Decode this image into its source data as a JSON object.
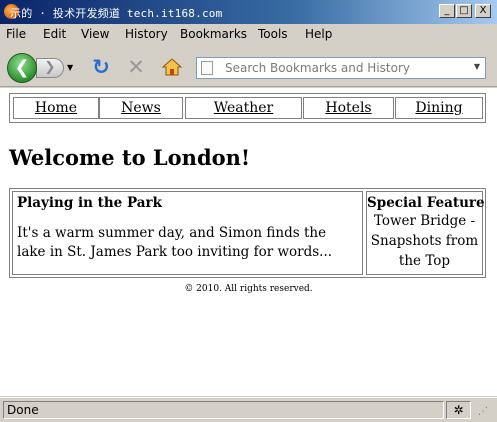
{
  "window": {
    "title": "示的   · 投术开发频道  tech.it168.com",
    "buttons": {
      "minimize": "_",
      "maximize": "□",
      "close": "X"
    }
  },
  "menu": {
    "items": [
      {
        "label": "File",
        "mnemonic": "F"
      },
      {
        "label": "Edit",
        "mnemonic": "E"
      },
      {
        "label": "View",
        "mnemonic": "V"
      },
      {
        "label": "History",
        "mnemonic": "s"
      },
      {
        "label": "Bookmarks",
        "mnemonic": "B"
      },
      {
        "label": "Tools",
        "mnemonic": "T"
      },
      {
        "label": "Help",
        "mnemonic": "H"
      }
    ]
  },
  "toolbar": {
    "back_glyph": "❮",
    "forward_glyph": "❯",
    "dropdown_glyph": "▼",
    "reload_glyph": "↻",
    "stop_glyph": "✕",
    "address_placeholder": "Search Bookmarks and History",
    "address_dropdown_glyph": "▼"
  },
  "page": {
    "nav": [
      "Home",
      "News",
      "Weather",
      "Hotels",
      "Dining"
    ],
    "heading": "Welcome to London!",
    "article": {
      "title": "Playing in the Park",
      "body": "It's a warm summer day, and Simon finds the lake in St. James Park too inviting for words..."
    },
    "feature": {
      "title": "Special Feature",
      "body": "Tower Bridge - Snapshots from the Top"
    },
    "footer": "© 2010.  All rights reserved."
  },
  "status": {
    "text": "Done",
    "addon_glyph": "✲",
    "grip_glyph": "⋰"
  },
  "colors": {
    "chrome": "#d4d0c8",
    "titlebar_start": "#0a246a",
    "accent_green": "#2f8f2f",
    "reload_blue": "#2a6fd0"
  }
}
